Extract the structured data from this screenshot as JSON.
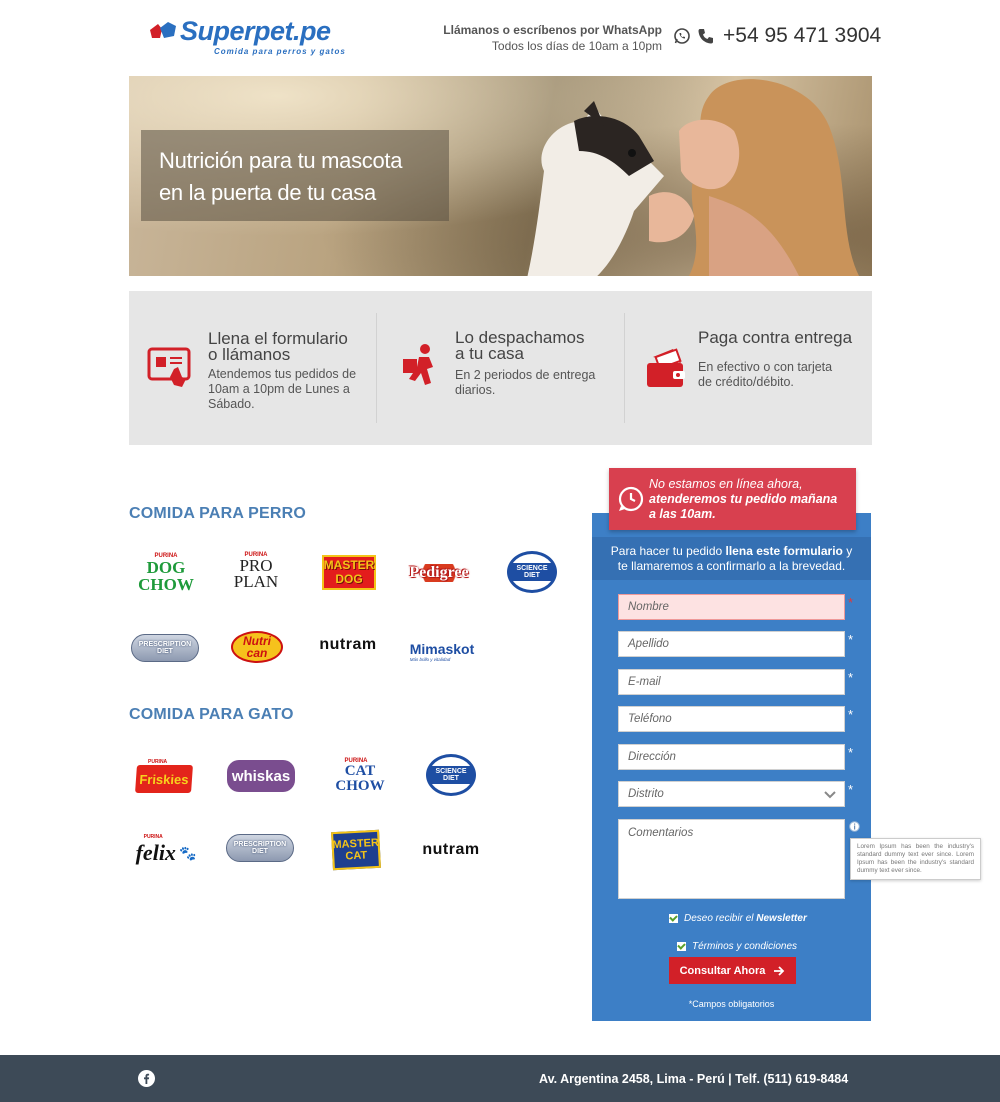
{
  "header": {
    "logo_main": "Superpet",
    "logo_suffix": ".pe",
    "logo_tagline": "Comida para perros y gatos",
    "contact_line1": "Llámanos o escríbenos por WhatsApp",
    "contact_line2": "Todos los días de 10am a 10pm",
    "phone": "+54 95 471 3904"
  },
  "hero": {
    "line1": "Nutrición para tu mascota",
    "line2": "en la puerta de tu casa"
  },
  "steps": [
    {
      "title1": "Llena el formulario",
      "title2": "o llámanos",
      "desc1": "Atendemos tus pedidos de",
      "desc2": "10am a 10pm de Lunes a",
      "desc3": "Sábado."
    },
    {
      "title1": "Lo despachamos",
      "title2": "a tu casa",
      "desc1": "En 2 periodos de entrega",
      "desc2": "diarios.",
      "desc3": ""
    },
    {
      "title1": "Paga contra entrega",
      "title2": "",
      "desc1": "En efectivo o con tarjeta",
      "desc2": "de crédito/débito.",
      "desc3": ""
    }
  ],
  "dog_section": {
    "title": "COMIDA PARA PERRO",
    "brands": [
      "DOG CHOW",
      "PRO PLAN",
      "MASTER DOG",
      "Pedigree",
      "SCIENCE DIET",
      "PRESCRIPTION DIET",
      "Nutri can",
      "nutram",
      "Mimaskot"
    ]
  },
  "cat_section": {
    "title": "COMIDA PARA GATO",
    "brands": [
      "Friskies",
      "whiskas",
      "CAT CHOW",
      "SCIENCE DIET",
      "felix",
      "PRESCRIPTION DIET",
      "MASTER CAT",
      "nutram"
    ]
  },
  "brand_small": {
    "purina": "PURINA",
    "hills": "Hill's",
    "mimaskot_tag": "Más brillo y vitalidad"
  },
  "notice": {
    "line1": "No estamos en línea ahora,",
    "line2": "atenderemos tu pedido mañana",
    "line3": "a las 10am."
  },
  "form": {
    "intro_pre": "Para hacer tu pedido ",
    "intro_bold": "llena este formulario",
    "intro_post": " y",
    "intro_line2": "te llamaremos a confirmarlo a la brevedad.",
    "fields": [
      "Nombre",
      "Apellido",
      "E-mail",
      "Teléfono",
      "Dirección"
    ],
    "district_value": "Distrito",
    "comments_placeholder": "Comentarios",
    "required_mark": "*",
    "tooltip": "Lorem Ipsum has been the industry's standard dummy text ever since. Lorem Ipsum has been the industry's standard dummy text ever since.",
    "newsletter_pre": "Deseo recibir el ",
    "newsletter_bold": "Newsletter",
    "terms": "Términos y condiciones",
    "submit": "Consultar Ahora",
    "required_note": "*Campos obligatorios"
  },
  "footer": {
    "address": "Av. Argentina 2458, Lima - Perú | Telf. (511) 619-8484"
  },
  "colors": {
    "brand_blue": "#2a6fc0",
    "form_blue": "#3d7fc6",
    "accent_red": "#d22028",
    "notice_red": "#d8404f",
    "footer": "#3d4a57"
  }
}
